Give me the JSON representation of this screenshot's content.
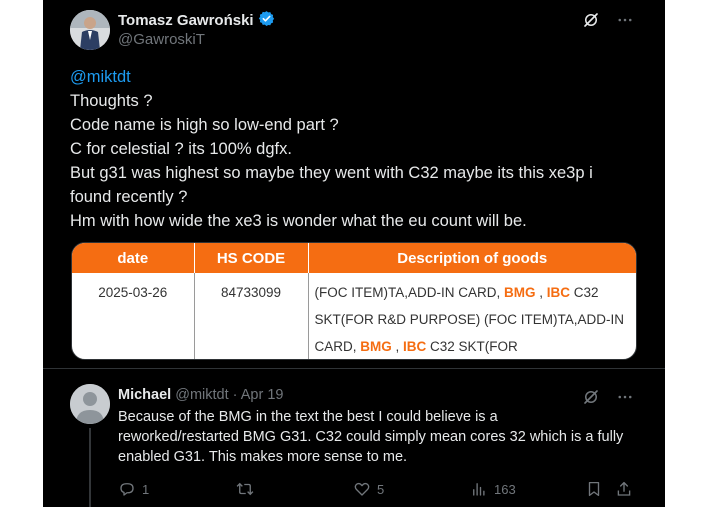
{
  "main_tweet": {
    "author_name": "Tomasz Gawroński",
    "handle": "@GawroskiT",
    "verified": true,
    "mention": "@miktdt",
    "lines": [
      "Thoughts ?",
      "Code name is high so low-end part ?",
      "C for celestial ? its 100% dgfx.",
      "But g31 was highest so maybe they went with C32 maybe its this xe3p i",
      "found recently ?",
      "Hm with how wide the xe3 is wonder what the eu count will be."
    ]
  },
  "media_table": {
    "headers": [
      "date",
      "HS CODE",
      "Description of goods"
    ],
    "row": {
      "date": "2025-03-26",
      "hs_code": "84733099",
      "desc_line1_a": "(FOC ITEM)TA,ADD-IN CARD, ",
      "desc_line1_bmg": "BMG",
      "desc_line1_sep": " , ",
      "desc_line1_ibc": "IBC",
      "desc_line1_b": " C32",
      "desc_line2": "SKT(FOR R&D PURPOSE) (FOC ITEM)TA,ADD-IN",
      "desc_line3_a": "CARD, ",
      "desc_line3_bmg": "BMG",
      "desc_line3_sep": " , ",
      "desc_line3_ibc": "IBC",
      "desc_line3_b": " C32 SKT(FOR"
    }
  },
  "reply": {
    "author_name": "Michael",
    "handle": "@miktdt",
    "separator": "·",
    "date": "Apr 19",
    "lines": [
      "Because of the BMG in the text the best I could believe is a",
      "reworked/restarted BMG G31. C32 could simply mean cores 32 which is a fully",
      "enabled G31. This makes more sense to me."
    ],
    "actions": {
      "replies": "1",
      "reposts": "",
      "likes": "5",
      "views": "163"
    }
  },
  "colors": {
    "background": "#000000",
    "text": "#e7e9ea",
    "muted": "#71767b",
    "link": "#1d9bf0",
    "verified": "#1d9bf0",
    "table_header": "#f56d12"
  }
}
